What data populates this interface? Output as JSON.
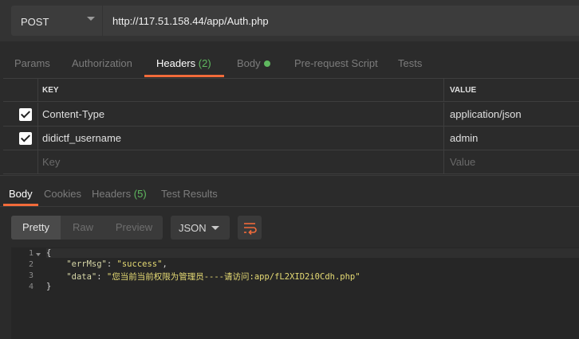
{
  "request": {
    "method": "POST",
    "url": "http://117.51.158.44/app/Auth.php"
  },
  "request_tabs": [
    {
      "label": "Params"
    },
    {
      "label": "Authorization"
    },
    {
      "label": "Headers",
      "count": "(2)"
    },
    {
      "label": "Body"
    },
    {
      "label": "Pre-request Script"
    },
    {
      "label": "Tests"
    }
  ],
  "headers_table": {
    "columns": {
      "key": "KEY",
      "value": "VALUE"
    },
    "rows": [
      {
        "key": "Content-Type",
        "value": "application/json",
        "checked": true
      },
      {
        "key": "didictf_username",
        "value": "admin",
        "checked": true
      }
    ],
    "placeholder": {
      "key": "Key",
      "value": "Value"
    }
  },
  "response_tabs": [
    {
      "label": "Body"
    },
    {
      "label": "Cookies"
    },
    {
      "label": "Headers",
      "count": "(5)"
    },
    {
      "label": "Test Results"
    }
  ],
  "view_modes": [
    "Pretty",
    "Raw",
    "Preview"
  ],
  "format": "JSON",
  "code": {
    "line_numbers": [
      "1",
      "2",
      "3",
      "4"
    ],
    "lines": {
      "l1": "{",
      "l2_key": "\"errMsg\"",
      "l2_sep": ": ",
      "l2_val": "\"success\"",
      "l2_end": ",",
      "l3_key": "\"data\"",
      "l3_sep": ": ",
      "l3_val": "\"您当前当前权限为管理员----请访问:app/fL2XID2i0Cdh.php\"",
      "l4": "}"
    }
  },
  "icons": {
    "method_dropdown": "chevron-down-icon",
    "format_dropdown": "chevron-down-icon",
    "wrap": "wrap-lines-icon",
    "checkbox": "checkmark-icon"
  },
  "colors": {
    "accent": "#f26b3a",
    "count_green": "#5fb85f"
  }
}
